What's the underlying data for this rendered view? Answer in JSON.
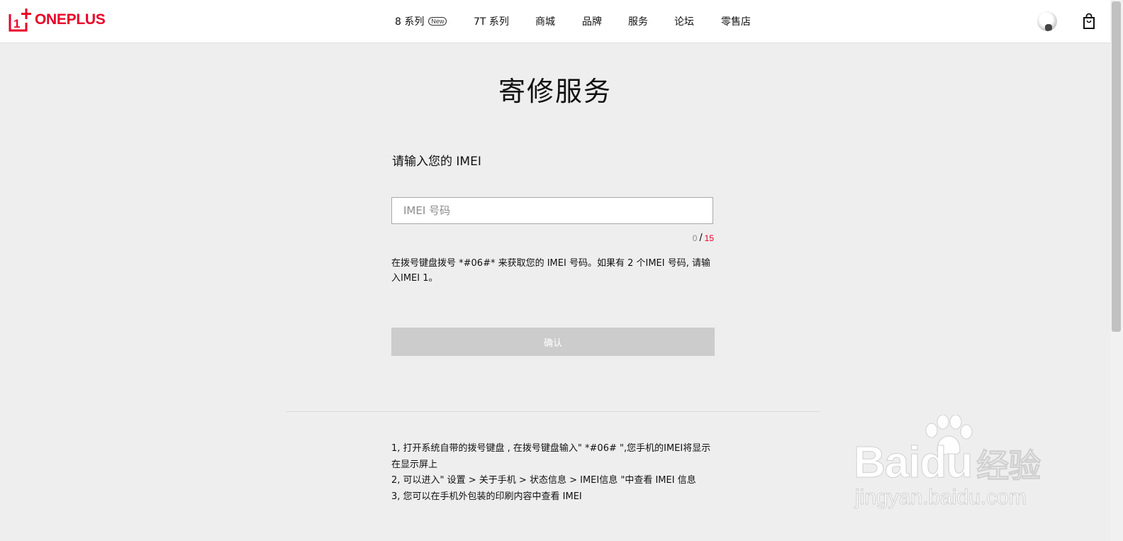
{
  "brand": {
    "name": "ONEPLUS",
    "color": "#eb0029"
  },
  "nav": {
    "items": [
      {
        "label": "8 系列",
        "badge": "New"
      },
      {
        "label": "7T 系列"
      },
      {
        "label": "商城"
      },
      {
        "label": "品牌"
      },
      {
        "label": "服务"
      },
      {
        "label": "论坛"
      },
      {
        "label": "零售店"
      }
    ]
  },
  "header_icons": {
    "avatar": "user-avatar",
    "cart": "shopping-bag-icon"
  },
  "page": {
    "title": "寄修服务",
    "imei_label": "请输入您的 IMEI",
    "imei_input": {
      "value": "",
      "placeholder": "IMEI 号码"
    },
    "counter": {
      "current": "0",
      "separator": "/",
      "max": "15"
    },
    "hint": "在拨号键盘拨号 *#06#* 来获取您的 IMEI 号码。如果有 2 个IMEI 号码, 请输入IMEI 1。",
    "confirm_label": "确认",
    "steps": [
      "1, 打开系统自带的拨号键盘 , 在拨号键盘输入\" *#06# \",您手机的IMEI将显示在显示屏上",
      "2, 可以进入\" 设置 > 关于手机 > 状态信息 > IMEI信息 \"中查看 IMEI 信息",
      "3, 您可以在手机外包装的印刷内容中查看 IMEI"
    ]
  },
  "watermark": {
    "main": "Bai",
    "main2": "du",
    "cn": "经验",
    "sub": "jingyan.baidu.com"
  }
}
